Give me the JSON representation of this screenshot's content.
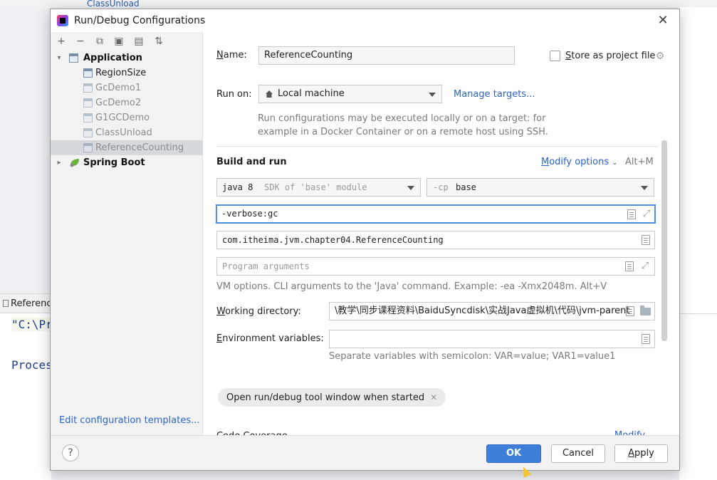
{
  "background": {
    "top_tab": "ClassUnload",
    "run_tab_label": "Referenc",
    "console_cmd": "\"C:\\Pr",
    "console_process": "Proces"
  },
  "dialog": {
    "title": "Run/Debug Configurations",
    "close_icon": "close-icon",
    "toolbar_icons": [
      "plus-icon",
      "minus-icon",
      "copy-icon",
      "save-icon",
      "folder-add-icon",
      "sort-icon"
    ]
  },
  "tree": {
    "application": "Application",
    "items": [
      "RegionSize",
      "GcDemo1",
      "GcDemo2",
      "G1GCDemo",
      "ClassUnload",
      "ReferenceCounting"
    ],
    "spring_boot": "Spring Boot"
  },
  "edit_templates": "Edit configuration templates...",
  "form": {
    "name_label_u": "N",
    "name_label_rest": "ame:",
    "name_value": "ReferenceCounting",
    "store_label_u": "S",
    "store_label_rest": "tore as project file",
    "run_on_label": "Run on:",
    "run_on_value": "Local machine",
    "manage_targets": "Manage targets...",
    "run_on_hint_1": "Run configurations may be executed locally or on a target: for",
    "run_on_hint_2": "example in a Docker Container or on a remote host using SSH.",
    "build_and_run": "Build and run",
    "modify_options_u": "M",
    "modify_options_rest": "odify options",
    "modify_shortcut": "Alt+M",
    "sdk_java": "java 8",
    "sdk_desc": "SDK of 'base' module",
    "cp_flag": "-cp",
    "cp_value": "base",
    "vm_options_value": "-verbose:gc",
    "main_class_value": "com.itheima.jvm.chapter04.ReferenceCounting",
    "program_args_placeholder": "Program arguments",
    "vm_hint": "VM options. CLI arguments to the 'Java' command. Example: -ea -Xmx2048m. Alt+V",
    "working_dir_label_u": "W",
    "working_dir_label_rest": "orking directory:",
    "working_dir_value": "\\教学\\同步课程资料\\BaiduSyncdisk\\实战Java虚拟机\\代码\\jvm-parent",
    "env_label_u": "E",
    "env_label_rest": "nvironment variables:",
    "env_value": "",
    "env_hint": "Separate variables with semicolon: VAR=value; VAR1=value1",
    "chip_label": "Open run/debug tool window when started",
    "code_coverage": "Code Coverage",
    "modify_link": "Modify"
  },
  "footer": {
    "help": "?",
    "ok": "OK",
    "cancel": "Cancel",
    "apply_u": "A",
    "apply_rest": "pply"
  },
  "colors": {
    "accent": "#3d7fd9",
    "link": "#2c63c7",
    "focus": "#4f8ee5"
  }
}
